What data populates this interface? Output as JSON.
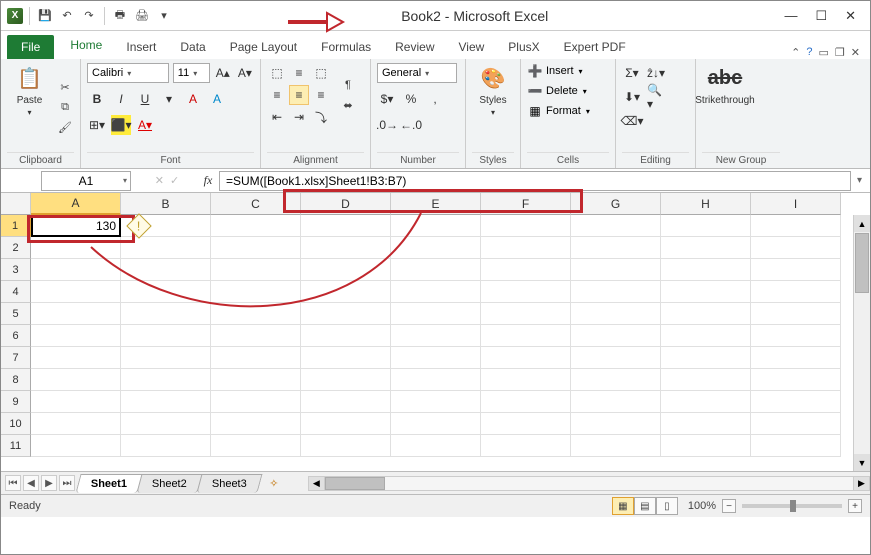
{
  "window": {
    "title": "Book2  -  Microsoft Excel"
  },
  "tabs": {
    "file": "File",
    "home": "Home",
    "insert": "Insert",
    "data": "Data",
    "page_layout": "Page Layout",
    "formulas": "Formulas",
    "review": "Review",
    "view": "View",
    "plusx": "PlusX",
    "expert_pdf": "Expert PDF"
  },
  "ribbon": {
    "clipboard": {
      "label": "Clipboard",
      "paste": "Paste"
    },
    "font": {
      "label": "Font",
      "name": "Calibri",
      "size": "11"
    },
    "alignment": {
      "label": "Alignment"
    },
    "number": {
      "label": "Number",
      "format": "General"
    },
    "styles": {
      "label": "Styles",
      "btn": "Styles"
    },
    "cells": {
      "label": "Cells",
      "insert": "Insert",
      "delete": "Delete",
      "format": "Format"
    },
    "editing": {
      "label": "Editing"
    },
    "newgroup": {
      "label": "New Group",
      "strike": "Strikethrough"
    }
  },
  "name_box": "A1",
  "formula": "=SUM([Book1.xlsx]Sheet1!B3:B7)",
  "columns": [
    "A",
    "B",
    "C",
    "D",
    "E",
    "F",
    "G",
    "H",
    "I"
  ],
  "rows": [
    "1",
    "2",
    "3",
    "4",
    "5",
    "6",
    "7",
    "8",
    "9",
    "10",
    "11"
  ],
  "cell_a1": "130",
  "sheets": {
    "s1": "Sheet1",
    "s2": "Sheet2",
    "s3": "Sheet3"
  },
  "status": "Ready",
  "zoom": "100%"
}
